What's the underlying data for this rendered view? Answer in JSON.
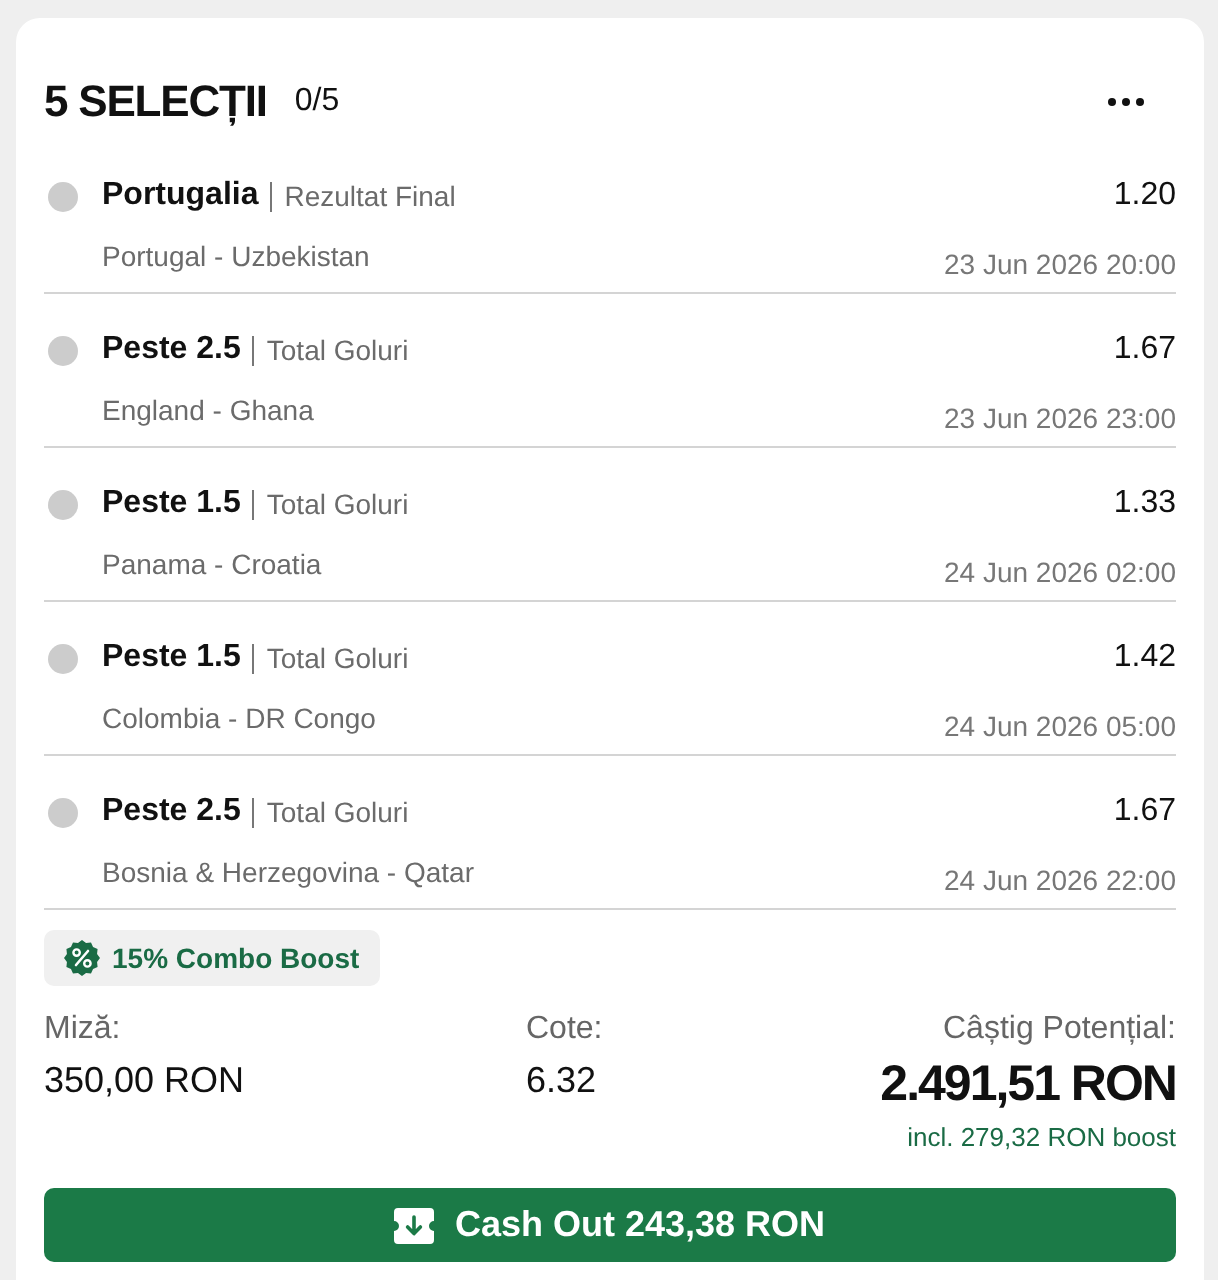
{
  "header": {
    "title": "5 SELECȚII",
    "count": "0/5"
  },
  "selections": [
    {
      "settled": false,
      "pick": "Portugalia",
      "market": "Rezultat Final",
      "odds": "1.20",
      "match": "Portugal - Uzbekistan",
      "date": "23 Jun 2026 20:00"
    },
    {
      "settled": false,
      "pick": "Peste 2.5",
      "market": "Total Goluri",
      "odds": "1.67",
      "match": "England - Ghana",
      "date": "23 Jun 2026 23:00"
    },
    {
      "settled": false,
      "pick": "Peste 1.5",
      "market": "Total Goluri",
      "odds": "1.33",
      "match": "Panama - Croatia",
      "date": "24 Jun 2026 02:00"
    },
    {
      "settled": false,
      "pick": "Peste 1.5",
      "market": "Total Goluri",
      "odds": "1.42",
      "match": "Colombia - DR Congo",
      "date": "24 Jun 2026 05:00"
    },
    {
      "settled": false,
      "pick": "Peste 2.5",
      "market": "Total Goluri",
      "odds": "1.67",
      "match": "Bosnia & Herzegovina - Qatar",
      "date": "24 Jun 2026 22:00"
    }
  ],
  "boost_badge": {
    "label": "15% Combo Boost"
  },
  "summary": {
    "stake": {
      "label": "Miză:",
      "value": "350,00 RON"
    },
    "odds": {
      "label": "Cote:",
      "value": "6.32"
    },
    "potential_win": {
      "label": "Câștig Potențial:",
      "value": "2.491,51 RON",
      "boost_note": "incl. 279,32 RON boost"
    }
  },
  "cash_out_button": {
    "label": "Cash Out 243,38 RON"
  }
}
